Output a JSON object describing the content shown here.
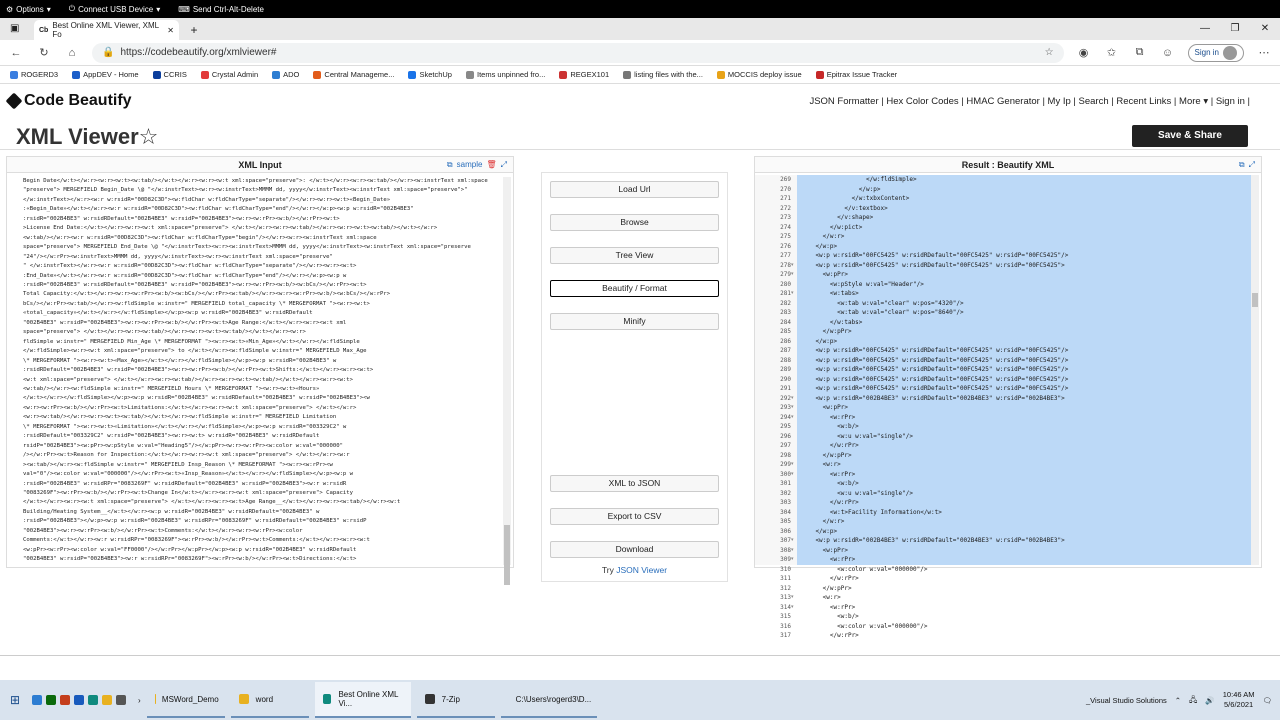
{
  "rdp_bar": {
    "options": "Options",
    "connect_usb": "Connect USB Device",
    "send_cad": "Send Ctrl-Alt-Delete"
  },
  "browser": {
    "tab_title": "Best Online XML Viewer, XML Fo",
    "url": "https://codebeautify.org/xmlviewer#",
    "signin": "Sign in",
    "bookmarks": [
      "ROGERD3",
      "AppDEV - Home",
      "CCRIS",
      "Crystal Admin",
      "ADO",
      "Central Manageme...",
      "SketchUp",
      "Items unpinned fro...",
      "REGEX101",
      "listing files with the...",
      "MOCCIS deploy issue",
      "Epitrax Issue Tracker"
    ]
  },
  "site": {
    "logo": "Code Beautify",
    "nav": "JSON Formatter | Hex Color Codes | HMAC Generator | My Ip | Search | Recent Links | More ▾ | Sign in |",
    "page_title": "XML Viewer☆",
    "save_share": "Save & Share"
  },
  "xml_input": {
    "header": "XML Input",
    "sample": "sample",
    "lines": [
      "Begin Date</w:t></w:r><w:r><w:t><w:tab/></w:t></w:r><w:r><w:t xml:space=\"preserve\">: </w:t></w:r><w:r><w:tab/></w:r><w:instrText xml:space",
      "\"preserve\"> MERGEFIELD Begin_Date \\@ \"</w:instrText><w:r><w:instrText>MMMM dd, yyyy</w:instrText><w:instrText xml:space=\"preserve\">\"",
      "</w:instrText></w:r><w:r w:rsidR=\"00D82C3D\"><w:fldChar w:fldCharType=\"separate\"/></w:r><w:r><w:t>«Begin_Date»",
      ":«Begin_Date»</w:t></w:r><w:r w:rsidR=\"00D82C3D\"><w:fldChar w:fldCharType=\"end\"/></w:r></w:p><w:p w:rsidR=\"002B4BE3\"",
      ":rsidR=\"002B4BE3\" w:rsidRDefault=\"002B4BE3\" w:rsidP=\"002B4BE3\"><w:r><w:rPr><w:b/></w:rPr><w:t>",
      ">License End Date:</w:t></w:r><w:r><w:t xml:space=\"preserve\"> </w:t></w:r><w:r><w:tab/></w:r><w:r><w:t><w:tab/></w:t></w:r>",
      "<w:tab/></w:r><w:r w:rsidR=\"00D82C3D\"><w:fldChar w:fldCharType=\"begin\"/></w:r><w:r><w:instrText xml:space",
      "space=\"preserve\"> MERGEFIELD End_Date \\@ \"</w:instrText><w:r><w:instrText>MMMM dd, yyyy</w:instrText><w:instrText xml:space=\"preserve",
      "\"24\"/></w:rPr><w:instrText>MMMM dd, yyyy</w:instrText><w:r><w:instrText xml:space=\"preserve\"",
      "\" </w:instrText></w:r><w:r w:rsidR=\"00D82C3D\"><w:fldChar w:fldCharType=\"separate\"/></w:r><w:r><w:t>",
      ":End_Date»</w:t></w:r><w:r w:rsidR=\"00D82C3D\"><w:fldChar w:fldCharType=\"end\"/></w:r></w:p><w:p w",
      ":rsidR=\"002B4BE3\" w:rsidRDefault=\"002B4BE3\" w:rsidP=\"002B4BE3\"><w:r><w:rPr><w:b/><w:bCs/></w:rPr><w:t>",
      "Total Capacity:</w:t></w:r><w:r><w:rPr><w:b/><w:bCs/></w:rPr><w:tab/></w:r><w:r><w:rPr><w:b/><w:bCs/></w:rPr>",
      "bCs/></w:rPr><w:tab/></w:r><w:fldSimple w:instr=\" MERGEFIELD total_capacity \\* MERGEFORMAT \"><w:r><w:t>",
      "«total_capacity»</w:t></w:r></w:fldSimple></w:p><w:p w:rsidR=\"002B4BE3\" w:rsidRDefault",
      "\"002B4BE3\" w:rsidP=\"002B4BE3\"><w:r><w:rPr><w:b/></w:rPr><w:t>Age Range:</w:t></w:r><w:r><w:t xml",
      "space=\"preserve\"> </w:t></w:r><w:r><w:tab/></w:r><w:r><w:t><w:tab/></w:t></w:r><w:r>",
      "fldSimple w:instr=\" MERGEFIELD Min_Age \\* MERGEFORMAT \"><w:r><w:t>«Min_Age»</w:t></w:r></w:fldSimple",
      "</w:fldSimple><w:r><w:t xml:space=\"preserve\"> to </w:t></w:r><w:fldSimple w:instr=\" MERGEFIELD Max_Age",
      "\\* MERGEFORMAT \"><w:r><w:t>«Max_Age»</w:t></w:r></w:fldSimple></w:p><w:p w:rsidR=\"002B4BE3\" w",
      ":rsidRDefault=\"002B4BE3\" w:rsidP=\"002B4BE3\"><w:r><w:rPr><w:b/></w:rPr><w:t>Shifts:</w:t></w:r><w:r><w:t>",
      "<w:t xml:space=\"preserve\"> </w:t></w:r><w:r><w:tab/></w:r><w:r><w:t><w:tab/></w:t></w:r><w:r><w:t>",
      "<w:tab/></w:r><w:fldSimple w:instr=\" MERGEFIELD Hours \\* MERGEFORMAT \"><w:r><w:t>«Hours»",
      "</w:t></w:r></w:fldSimple></w:p><w:p w:rsidR=\"002B4BE3\" w:rsidRDefault=\"002B4BE3\" w:rsidP=\"002B4BE3\"><w",
      "<w:r><w:rPr><w:b/></w:rPr><w:t>Limitations:</w:t></w:r><w:r><w:t xml:space=\"preserve\"> </w:t></w:r>",
      "<w:r><w:tab/></w:r><w:r><w:t><w:tab/></w:t></w:r><w:fldSimple w:instr=\" MERGEFIELD Limitation",
      "\\* MERGEFORMAT \"><w:r><w:t>«Limitation»</w:t></w:r></w:fldSimple></w:p><w:p w:rsidR=\"003329C2\" w",
      ":rsidRDefault=\"003329C2\" w:rsidP=\"002B4BE3\"><w:r><w:t> w:rsidR=\"002B4BE3\" w:rsidRDefault",
      "rsidP=\"002B4BE3\"><w:pPr><w:pStyle w:val=\"Heading5\"/></w:pPr><w:r><w:rPr><w:color w:val=\"000000\"",
      "/></w:rPr><w:t>Reason for Inspection:</w:t></w:r><w:r><w:t xml:space=\"preserve\"> </w:t></w:r><w:r",
      "><w:tab/></w:r><w:fldSimple w:instr=\" MERGEFIELD Insp_Reason \\* MERGEFORMAT \"><w:r><w:rPr><w",
      "val=\"0\"/><w:color w:val=\"000000\"/></w:rPr><w:t>«Insp_Reason»</w:t></w:r></w:fldSimple></w:p><w:p w",
      ":rsidR=\"002B4BE3\" w:rsidRPr=\"0083269F\" w:rsidRDefault=\"002B4BE3\" w:rsidP=\"002B4BE3\"><w:r w:rsidR",
      "\"0083269F\"><w:rPr><w:b/></w:rPr><w:t>Change In</w:t></w:r><w:r><w:t xml:space=\"preserve\"> Capacity",
      "</w:t></w:r><w:r><w:t xml:space=\"preserve\"> </w:t></w:r><w:r><w:t>Age Range__</w:t></w:r><w:r><w:tab/></w:r><w:t",
      "Building/Heating System__</w:t></w:r><w:p w:rsidR=\"002B4BE3\" w:rsidRDefault=\"002B4BE3\" w",
      ":rsidP=\"002B4BE3\"></w:p><w:p w:rsidR=\"002B4BE3\" w:rsidRPr=\"0083269F\" w:rsidRDefault=\"002B4BE3\" w:rsidP",
      "\"002B4BE3\"><w:r><w:rPr><w:b/></w:rPr><w:t>Comments:</w:t></w:r><w:r><w:rPr><w:color",
      "Comments:</w:t></w:r><w:r w:rsidRPr=\"0083269F\"><w:rPr><w:b/></w:rPr><w:t>Comments:</w:t></w:r><w:r><w:t",
      "<w:pPr><w:rPr><w:color w:val=\"FF0000\"/></w:rPr></w:pPr></w:p><w:p w:rsidR=\"002B4BE3\" w:rsidRDefault",
      "\"002B4BE3\" w:rsidP=\"002B4BE3\"><w:r w:rsidRPr=\"0083269F\"><w:rPr><w:b/></w:rPr><w:t>Directions:</w:t>",
      "<w:r><w:tab/></w:r><w:fldSimple w:instr=\" MERGEFIELD Directions \\* MERGEFORMAT \"><w:r><w:t>",
      "«Directions»</w:t></w:r></w:fldSimple></w:p><w:p w:rsidR=\"002B4BE3\" w:rsidRDefault=\"002B4BE3\" w",
      ":rsidP=\"002B4BE3\"><w:pPr><w:rPr><w:color w:val=\"FF0000\"/></w:rPr></w:pPr></w:p><w:p w:rsidR",
      "\"002B4BE3\" w:rsidRDefault=\"002B4BE3\" w:rsidP=\"002B4BE3\"><w:pPr><w:rPr><w:color w:val=\"FF0000\"",
      ":rPr></w:pPr></w:p><w:p w:rsidR=\"001B4482\" w:rsidRPr=\"00FC5425\" w:rsidRDefault=\"001B4482\" w:rsidP"
    ]
  },
  "actions": {
    "load_url": "Load Url",
    "browse": "Browse",
    "tree_view": "Tree View",
    "beautify": "Beautify / Format",
    "minify": "Minify",
    "xml_to_json": "XML to JSON",
    "export_csv": "Export to CSV",
    "download": "Download",
    "try_prefix": "Try",
    "try_link": "JSON Viewer"
  },
  "result": {
    "header": "Result : Beautify XML",
    "lines": [
      {
        "n": "269",
        "f": "",
        "i": 0,
        "t": "                  </w:fldSimple>"
      },
      {
        "n": "270",
        "f": "",
        "i": 0,
        "t": "                </w:p>"
      },
      {
        "n": "271",
        "f": "",
        "i": 0,
        "t": "              </w:txbxContent>"
      },
      {
        "n": "272",
        "f": "",
        "i": 0,
        "t": "            </v:textbox>"
      },
      {
        "n": "273",
        "f": "",
        "i": 0,
        "t": "          </v:shape>"
      },
      {
        "n": "274",
        "f": "",
        "i": 0,
        "t": "        </w:pict>"
      },
      {
        "n": "275",
        "f": "",
        "i": 0,
        "t": "      </w:r>"
      },
      {
        "n": "276",
        "f": "",
        "i": 0,
        "t": "    </w:p>"
      },
      {
        "n": "277",
        "f": "",
        "i": 0,
        "t": "    <w:p w:rsidR=\"00FC5425\" w:rsidRDefault=\"00FC5425\" w:rsidP=\"00FC5425\"/>"
      },
      {
        "n": "278",
        "f": "▾",
        "i": 0,
        "t": "    <w:p w:rsidR=\"00FC5425\" w:rsidRDefault=\"00FC5425\" w:rsidP=\"00FC5425\">"
      },
      {
        "n": "279",
        "f": "▾",
        "i": 0,
        "t": "      <w:pPr>"
      },
      {
        "n": "280",
        "f": "",
        "i": 0,
        "t": "        <w:pStyle w:val=\"Header\"/>"
      },
      {
        "n": "281",
        "f": "▾",
        "i": 0,
        "t": "        <w:tabs>"
      },
      {
        "n": "282",
        "f": "",
        "i": 0,
        "t": "          <w:tab w:val=\"clear\" w:pos=\"4320\"/>"
      },
      {
        "n": "283",
        "f": "",
        "i": 0,
        "t": "          <w:tab w:val=\"clear\" w:pos=\"8640\"/>"
      },
      {
        "n": "284",
        "f": "",
        "i": 0,
        "t": "        </w:tabs>"
      },
      {
        "n": "285",
        "f": "",
        "i": 0,
        "t": "      </w:pPr>"
      },
      {
        "n": "286",
        "f": "",
        "i": 0,
        "t": "    </w:p>"
      },
      {
        "n": "287",
        "f": "",
        "i": 0,
        "t": "    <w:p w:rsidR=\"00FC5425\" w:rsidRDefault=\"00FC5425\" w:rsidP=\"00FC5425\"/>"
      },
      {
        "n": "288",
        "f": "",
        "i": 0,
        "t": "    <w:p w:rsidR=\"00FC5425\" w:rsidRDefault=\"00FC5425\" w:rsidP=\"00FC5425\"/>"
      },
      {
        "n": "289",
        "f": "",
        "i": 0,
        "t": "    <w:p w:rsidR=\"00FC5425\" w:rsidRDefault=\"00FC5425\" w:rsidP=\"00FC5425\"/>"
      },
      {
        "n": "290",
        "f": "",
        "i": 0,
        "t": "    <w:p w:rsidR=\"00FC5425\" w:rsidRDefault=\"00FC5425\" w:rsidP=\"00FC5425\"/>"
      },
      {
        "n": "291",
        "f": "",
        "i": 0,
        "t": "    <w:p w:rsidR=\"00FC5425\" w:rsidRDefault=\"00FC5425\" w:rsidP=\"00FC5425\"/>"
      },
      {
        "n": "292",
        "f": "▾",
        "i": 0,
        "t": "    <w:p w:rsidR=\"002B4BE3\" w:rsidRDefault=\"002B4BE3\" w:rsidP=\"002B4BE3\">"
      },
      {
        "n": "293",
        "f": "▾",
        "i": 0,
        "t": "      <w:pPr>"
      },
      {
        "n": "294",
        "f": "▾",
        "i": 0,
        "t": "        <w:rPr>"
      },
      {
        "n": "295",
        "f": "",
        "i": 0,
        "t": "          <w:b/>"
      },
      {
        "n": "296",
        "f": "",
        "i": 0,
        "t": "          <w:u w:val=\"single\"/>"
      },
      {
        "n": "297",
        "f": "",
        "i": 0,
        "t": "        </w:rPr>"
      },
      {
        "n": "298",
        "f": "",
        "i": 0,
        "t": "      </w:pPr>"
      },
      {
        "n": "299",
        "f": "▾",
        "i": 0,
        "t": "      <w:r>"
      },
      {
        "n": "300",
        "f": "▾",
        "i": 0,
        "t": "        <w:rPr>"
      },
      {
        "n": "301",
        "f": "",
        "i": 0,
        "t": "          <w:b/>"
      },
      {
        "n": "302",
        "f": "",
        "i": 0,
        "t": "          <w:u w:val=\"single\"/>"
      },
      {
        "n": "303",
        "f": "",
        "i": 0,
        "t": "        </w:rPr>"
      },
      {
        "n": "304",
        "f": "",
        "i": 0,
        "t": "        <w:t>Facility Information</w:t>"
      },
      {
        "n": "305",
        "f": "",
        "i": 0,
        "t": "      </w:r>"
      },
      {
        "n": "306",
        "f": "",
        "i": 0,
        "t": "    </w:p>"
      },
      {
        "n": "307",
        "f": "▾",
        "i": 0,
        "t": "    <w:p w:rsidR=\"002B4BE3\" w:rsidRDefault=\"002B4BE3\" w:rsidP=\"002B4BE3\">"
      },
      {
        "n": "308",
        "f": "▾",
        "i": 0,
        "t": "      <w:pPr>"
      },
      {
        "n": "309",
        "f": "▾",
        "i": 0,
        "t": "        <w:rPr>"
      },
      {
        "n": "310",
        "f": "",
        "i": 0,
        "t": "          <w:color w:val=\"000000\"/>"
      },
      {
        "n": "311",
        "f": "",
        "i": 0,
        "t": "        </w:rPr>"
      },
      {
        "n": "312",
        "f": "",
        "i": 0,
        "t": "      </w:pPr>"
      },
      {
        "n": "313",
        "f": "▾",
        "i": 0,
        "t": "      <w:r>"
      },
      {
        "n": "314",
        "f": "▾",
        "i": 0,
        "t": "        <w:rPr>"
      },
      {
        "n": "315",
        "f": "",
        "i": 0,
        "t": "          <w:b/>"
      },
      {
        "n": "316",
        "f": "",
        "i": 0,
        "t": "          <w:color w:val=\"000000\"/>"
      },
      {
        "n": "317",
        "f": "",
        "i": 0,
        "t": "        </w:rPr>"
      }
    ]
  },
  "taskbar": {
    "items": [
      "MSWord_Demo",
      "word",
      "Best Online XML Vi...",
      "7-Zip",
      "C:\\Users\\rogerd3\\D..."
    ],
    "tray_label": "_Visual Studio Solutions",
    "time": "10:46 AM",
    "date": "5/6/2021"
  },
  "colors": {
    "selection": "#bcd9f7",
    "accent": "#2a6ebb",
    "save_button": "#222222"
  }
}
